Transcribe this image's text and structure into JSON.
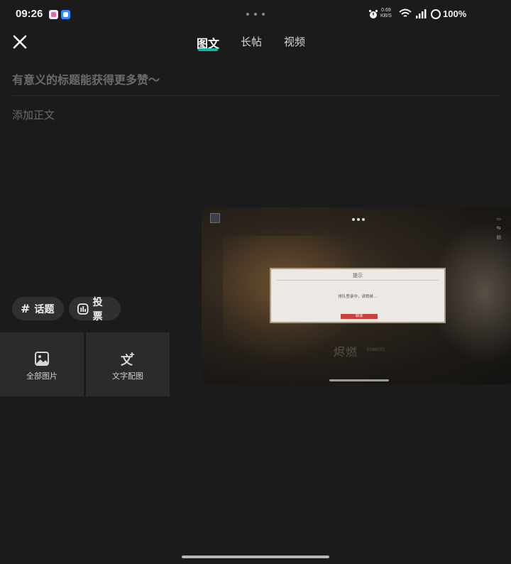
{
  "status_bar": {
    "time": "09:26",
    "net_speed": "0.69\nKB/S",
    "battery": "100%"
  },
  "header": {
    "tabs": [
      {
        "label": "图文",
        "active": true
      },
      {
        "label": "长帖",
        "active": false
      },
      {
        "label": "视频",
        "active": false
      }
    ],
    "accent_color": "#16b3a6"
  },
  "editor": {
    "title_placeholder": "有意义的标题能获得更多赞～",
    "body_placeholder": "添加正文"
  },
  "chips": {
    "topic_label": "话题",
    "vote_label": "投票"
  },
  "picker": {
    "all_images_label": "全部图片",
    "text_to_image_label": "文字配图"
  },
  "floating_window": {
    "dialog_title": "提示",
    "dialog_message": "排队登录中，请稍候…",
    "dialog_button": "取消",
    "logo_text": "烬燃",
    "logo_sub": "EMBERS"
  }
}
